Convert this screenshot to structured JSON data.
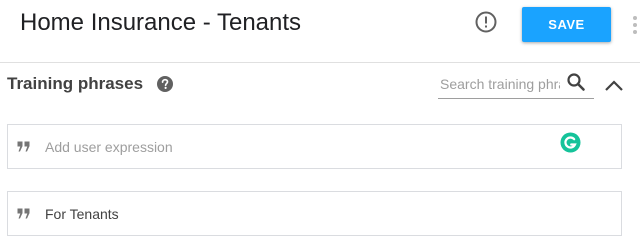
{
  "header": {
    "title": "Home Insurance - Tenants",
    "save_label": "SAVE",
    "alert_icon": "exclamation-circle-icon",
    "more_icon": "more-vert-icon"
  },
  "training_phrases": {
    "title": "Training phrases",
    "help_icon": "help-circle-icon",
    "search": {
      "placeholder": "Search training phrases",
      "value": "",
      "icon": "search-icon"
    },
    "collapse_icon": "chevron-up-icon",
    "new_expression": {
      "placeholder": "Add user expression",
      "value": "",
      "quote_icon": "quote-icon",
      "extension_icon": "grammarly-icon"
    },
    "phrases": [
      {
        "text": "For Tenants",
        "quote_icon": "quote-icon"
      }
    ]
  },
  "colors": {
    "accent": "#1aa3ff",
    "grammarly": "#15c39a",
    "border": "#dadce0",
    "text": "#202124",
    "muted": "#9e9e9e"
  }
}
